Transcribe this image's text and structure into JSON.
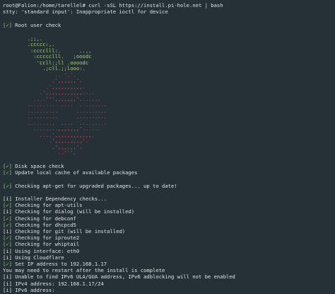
{
  "terminal": {
    "command": "root@Falion:/home/tarellel# curl -sSL https://install.pi-hole.net | bash",
    "stty_warning": "stty: 'standard input': Inappropriate ioctl for device",
    "root_check_tag": "[✓]",
    "root_check_text": " Root user check",
    "logo_green": [
      "        .;;,.",
      "        .ccccc:,.",
      "         :cccclll:.      ..,,",
      "          :ccccclll.   ;ooodc",
      "           'ccll:;ll .oooodc",
      "             .;cll.;;looo:."
    ],
    "logo_red": [
      "                 .. ','.",
      "                .',,,,,,'.",
      "              .',,,,,,,,,,.",
      "            .',,,,,,,,,,,,....",
      "          ....''',,,,,,,'.......",
      "        .........  ....  .........",
      "        ..........      ..........",
      "        ..........      ..........",
      "        .........  ....  .........",
      "          ........,,,,,,,'......",
      "            ....',,,,,,,,,,,,.",
      "               .',,,,,,,,,'.",
      "                .',,,,,,'.",
      "                  ..'''."
    ],
    "checks_a": [
      {
        "tag": "[✓]",
        "text": " Disk space check"
      },
      {
        "tag": "[✓]",
        "text": " Update local cache of available packages"
      }
    ],
    "apt_check": {
      "tag": "[✓]",
      "text": " Checking apt-get for upgraded packages... up to date!"
    },
    "checks_b": [
      {
        "tag": "[i]",
        "text": " Installer Dependency checks..."
      },
      {
        "tag": "[✓]",
        "text": " Checking for apt-utils"
      },
      {
        "tag": "[i]",
        "text": " Checking for dialog (will be installed)"
      },
      {
        "tag": "[✓]",
        "text": " Checking for debconf"
      },
      {
        "tag": "[✓]",
        "text": " Checking for dhcpcd5"
      },
      {
        "tag": "[i]",
        "text": " Checking for git (will be installed)"
      },
      {
        "tag": "[✓]",
        "text": " Checking for iproute2"
      },
      {
        "tag": "[✓]",
        "text": " Checking for whiptail"
      },
      {
        "tag": "[i]",
        "text": " Using interface: eth0"
      },
      {
        "tag": "[i]",
        "text": " Using Cloudflare"
      },
      {
        "tag": "[✓]",
        "text": " Set IP address to 192.168.1.17"
      }
    ],
    "restart_note": "You may need to restart after the install is complete",
    "checks_c": [
      {
        "tag": "[i]",
        "text": " Unable to find IPv6 ULA/GUA address, IPv6 adblocking will not be enabled"
      },
      {
        "tag": "[i]",
        "text": " IPv4 address: 192.168.1.17/24"
      },
      {
        "tag": "[i]",
        "text": " IPv6 address:"
      }
    ],
    "colors": {
      "background": "#263137",
      "text": "#dfe3e2",
      "check_green": "#8fd16b",
      "logo_green": "#a7dc5a",
      "logo_red": "#e04a55"
    }
  }
}
